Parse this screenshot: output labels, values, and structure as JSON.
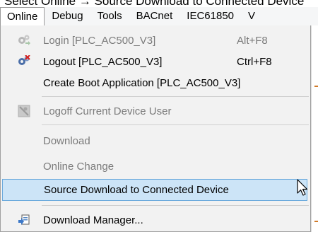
{
  "caption": "Select Online → Source Download to Connected Device",
  "menubar": {
    "items": [
      {
        "label": "Online",
        "active": true
      },
      {
        "label": "Debug"
      },
      {
        "label": "Tools"
      },
      {
        "label": "BACnet"
      },
      {
        "label": "IEC61850"
      },
      {
        "label": "V"
      }
    ]
  },
  "menu": {
    "login": {
      "label": "Login [PLC_AC500_V3]",
      "shortcut": "Alt+F8",
      "icon": "login-gears-icon"
    },
    "logout": {
      "label": "Logout [PLC_AC500_V3]",
      "shortcut": "Ctrl+F8",
      "icon": "logout-gears-icon"
    },
    "create_boot": {
      "label": "Create Boot Application [PLC_AC500_V3]"
    },
    "logoff_user": {
      "label": "Logoff Current Device User",
      "icon": "logoff-user-icon"
    },
    "download": {
      "label": "Download"
    },
    "online_change": {
      "label": "Online Change"
    },
    "source_download": {
      "label": "Source Download to Connected Device"
    },
    "download_manager": {
      "label": "Download Manager...",
      "icon": "download-manager-icon"
    }
  },
  "colors": {
    "highlight_bg": "#cce4f7",
    "highlight_border": "#6aa9dc",
    "disabled_text": "#7b7b7b",
    "menu_bg": "#f2f2f2"
  }
}
